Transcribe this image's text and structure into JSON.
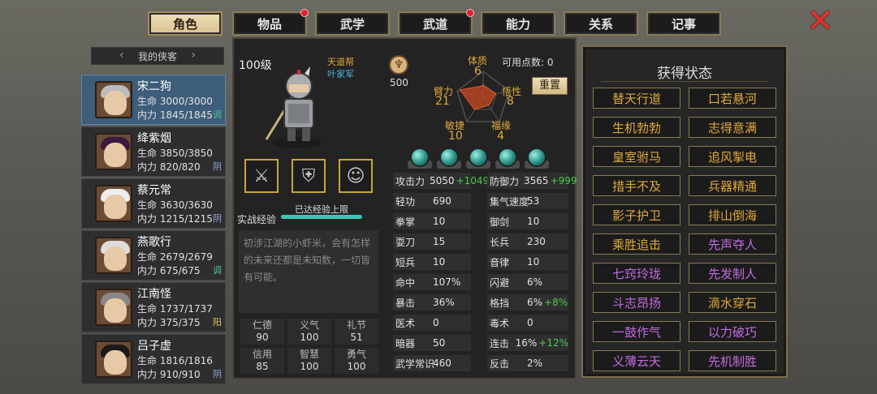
{
  "tabs": [
    {
      "label": "角色",
      "active": true,
      "notify": false
    },
    {
      "label": "物品",
      "active": false,
      "notify": true
    },
    {
      "label": "武学",
      "active": false,
      "notify": false
    },
    {
      "label": "武道",
      "active": false,
      "notify": true
    },
    {
      "label": "能力",
      "active": false,
      "notify": false
    },
    {
      "label": "关系",
      "active": false,
      "notify": false
    },
    {
      "label": "记事",
      "active": false,
      "notify": false
    }
  ],
  "roster": {
    "title": "我的侠客",
    "heroes": [
      {
        "name": "宋二狗",
        "hp": "生命 3000/3000",
        "mp": "内力 1845/1845",
        "tag": "调",
        "tag_color": "#4fc08f",
        "selected": true,
        "hair": "#bbbbbb"
      },
      {
        "name": "绛紫烟",
        "hp": "生命 3850/3850",
        "mp": "内力 820/820",
        "tag": "阴",
        "tag_color": "#8fa6d8",
        "selected": false,
        "hair": "#3a1a3f"
      },
      {
        "name": "蔡元常",
        "hp": "生命 3630/3630",
        "mp": "内力 1215/1215",
        "tag": "阴",
        "tag_color": "#8fa6d8",
        "selected": false,
        "hair": "#eeeeee"
      },
      {
        "name": "燕歌行",
        "hp": "生命 2679/2679",
        "mp": "内力 675/675",
        "tag": "调",
        "tag_color": "#4fc08f",
        "selected": false,
        "hair": "#dddddd"
      },
      {
        "name": "江南怪",
        "hp": "生命 1737/1737",
        "mp": "内力 375/375",
        "tag": "阳",
        "tag_color": "#d9c060",
        "selected": false,
        "hair": "#888888"
      },
      {
        "name": "吕子虚",
        "hp": "生命 1816/1816",
        "mp": "内力 910/910",
        "tag": "阴",
        "tag_color": "#8fa6d8",
        "selected": false,
        "hair": "#1a1a1a"
      }
    ]
  },
  "character": {
    "level": "100级",
    "faction": "天道帮",
    "clan": "叶家军",
    "fame": "500",
    "points_label": "可用点数: 0",
    "reset_label": "重置",
    "radar": {
      "tizhi_label": "体质",
      "tizhi": "6",
      "bili_label": "臂力",
      "bili": "21",
      "xinxing_label": "悟性",
      "xinxing": "8",
      "minjie_label": "敏捷",
      "minjie": "10",
      "fuyuan_label": "福缘",
      "fuyuan": "4"
    },
    "exp_label": "实战经验",
    "exp_text": "已达经验上限",
    "exp_fraction": 1.0,
    "description": "初涉江湖的小虾米，会有怎样的未来还都是未知数，一切皆有可能。",
    "virtues": [
      {
        "k": "仁德",
        "v": "90"
      },
      {
        "k": "义气",
        "v": "100"
      },
      {
        "k": "礼节",
        "v": "51"
      },
      {
        "k": "信用",
        "v": "85"
      },
      {
        "k": "智慧",
        "v": "100"
      },
      {
        "k": "勇气",
        "v": "100"
      }
    ]
  },
  "stats_left": [
    {
      "lab": "攻击力",
      "val": "5050",
      "bonus": "+1049"
    },
    {
      "lab": "轻功",
      "val": "690",
      "bonus": ""
    },
    {
      "lab": "拳掌",
      "val": "10",
      "bonus": ""
    },
    {
      "lab": "耍刀",
      "val": "15",
      "bonus": ""
    },
    {
      "lab": "短兵",
      "val": "10",
      "bonus": ""
    },
    {
      "lab": "命中",
      "val": "107%",
      "bonus": ""
    },
    {
      "lab": "暴击",
      "val": "36%",
      "bonus": ""
    },
    {
      "lab": "医术",
      "val": "0",
      "bonus": ""
    },
    {
      "lab": "暗器",
      "val": "50",
      "bonus": ""
    },
    {
      "lab": "武学常识",
      "val": "460",
      "bonus": ""
    }
  ],
  "stats_right": [
    {
      "lab": "防御力",
      "val": "3565",
      "bonus": "+999"
    },
    {
      "lab": "集气速度",
      "val": "53",
      "bonus": ""
    },
    {
      "lab": "御剑",
      "val": "10",
      "bonus": ""
    },
    {
      "lab": "长兵",
      "val": "230",
      "bonus": ""
    },
    {
      "lab": "音律",
      "val": "10",
      "bonus": ""
    },
    {
      "lab": "闪避",
      "val": "6%",
      "bonus": ""
    },
    {
      "lab": "格挡",
      "val": "6%",
      "bonus": "+8%"
    },
    {
      "lab": "毒术",
      "val": "0",
      "bonus": ""
    },
    {
      "lab": "连击",
      "val": "16%",
      "bonus": "+12%"
    },
    {
      "lab": "反击",
      "val": "2%",
      "bonus": ""
    }
  ],
  "status_panel": {
    "title": "获得状态",
    "items": [
      {
        "label": "替天行道",
        "color": "#e0a93a"
      },
      {
        "label": "口若悬河",
        "color": "#e0a93a"
      },
      {
        "label": "生机勃勃",
        "color": "#e0a93a"
      },
      {
        "label": "志得意满",
        "color": "#e0a93a"
      },
      {
        "label": "皇室驸马",
        "color": "#e0a93a"
      },
      {
        "label": "追风掣电",
        "color": "#e0a93a"
      },
      {
        "label": "措手不及",
        "color": "#e0a93a"
      },
      {
        "label": "兵器精通",
        "color": "#e0a93a"
      },
      {
        "label": "影子护卫",
        "color": "#e0a93a"
      },
      {
        "label": "排山倒海",
        "color": "#e0a93a"
      },
      {
        "label": "乘胜追击",
        "color": "#e0a93a"
      },
      {
        "label": "先声夺人",
        "color": "#c26be0"
      },
      {
        "label": "七窍玲珑",
        "color": "#c26be0"
      },
      {
        "label": "先发制人",
        "color": "#c26be0"
      },
      {
        "label": "斗志昂扬",
        "color": "#c26be0"
      },
      {
        "label": "滴水穿石",
        "color": "#e0a93a"
      },
      {
        "label": "一鼓作气",
        "color": "#c26be0"
      },
      {
        "label": "以力破巧",
        "color": "#c26be0"
      },
      {
        "label": "义薄云天",
        "color": "#c26be0"
      },
      {
        "label": "先机制胜",
        "color": "#c26be0"
      }
    ]
  },
  "colors": {
    "accent_gold": "#c9a53c",
    "exp_bar": "#39c8b8",
    "bonus_green": "#4cc94c"
  }
}
